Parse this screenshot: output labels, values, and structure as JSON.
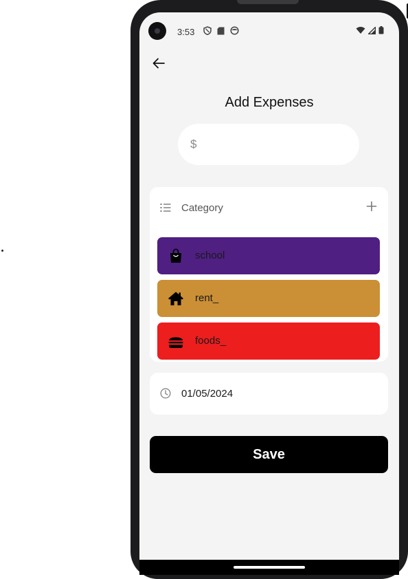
{
  "status_bar": {
    "time": "3:53"
  },
  "page": {
    "title": "Add Expenses"
  },
  "amount_field": {
    "prefix": "$",
    "value": ""
  },
  "category": {
    "label": "Category",
    "items": [
      {
        "name": "school",
        "icon": "shopping-bag-icon",
        "color": "#4f1f82"
      },
      {
        "name": "rent_",
        "icon": "house-icon",
        "color": "#cb8f35"
      },
      {
        "name": "foods_",
        "icon": "burger-icon",
        "color": "#ec1e1e"
      }
    ]
  },
  "date_field": {
    "value": "01/05/2024"
  },
  "actions": {
    "save_label": "Save"
  }
}
